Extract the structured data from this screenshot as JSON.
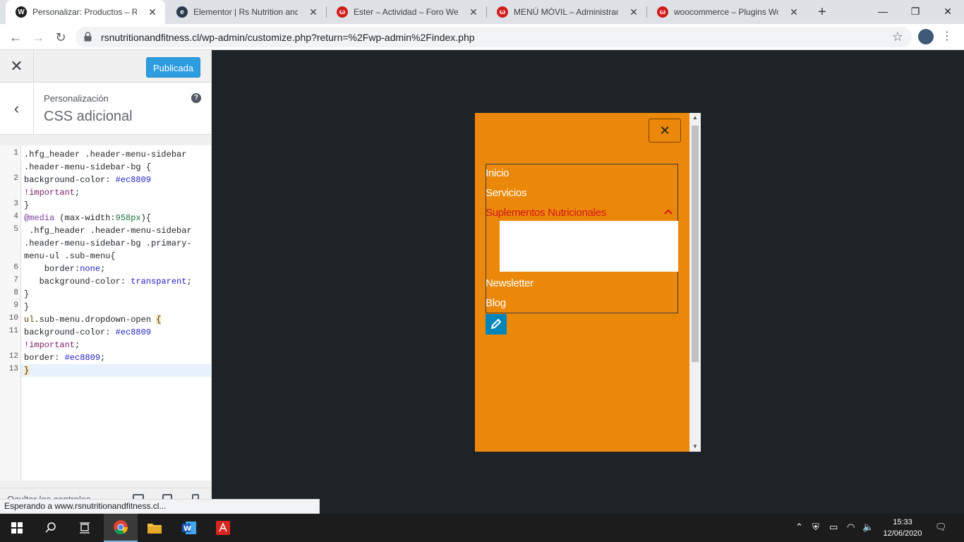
{
  "browser": {
    "tabs": [
      {
        "title": "Personalizar: Productos – Rs Nutrition",
        "favicon": "wordpress-icon",
        "active": true
      },
      {
        "title": "Elementor | Rs Nutrition and Fitness",
        "favicon": "elementor-icon",
        "active": false
      },
      {
        "title": "Ester – Actividad – Foro Webempresa",
        "favicon": "webempresa-icon",
        "active": false
      },
      {
        "title": "MENÚ MÓVIL – Administración",
        "favicon": "webempresa-icon",
        "active": false
      },
      {
        "title": "woocommerce – Plugins WordPress",
        "favicon": "webempresa-icon",
        "active": false
      }
    ],
    "url": "rsnutritionandfitness.cl/wp-admin/customize.php?return=%2Fwp-admin%2Findex.php",
    "status_text": "Esperando a www.rsnutritionandfitness.cl..."
  },
  "customizer": {
    "publish_label": "Publicada",
    "breadcrumb": "Personalización",
    "section_title": "CSS adicional",
    "help_glyph": "?",
    "footer_label": "Ocultar los controles",
    "line_numbers": [
      "1",
      "2",
      "3",
      "4",
      "5",
      "6",
      "7",
      "8",
      "9",
      "10",
      "11",
      "12",
      "13"
    ]
  },
  "preview": {
    "menu_items": [
      "Inicio",
      "Servicios",
      "Suplementos Nutricionales",
      "Newsletter",
      "Blog"
    ],
    "open_item_color": "#d4141b",
    "background_color": "#ec8809"
  },
  "taskbar": {
    "time": "15:33",
    "date": "12/06/2020"
  }
}
